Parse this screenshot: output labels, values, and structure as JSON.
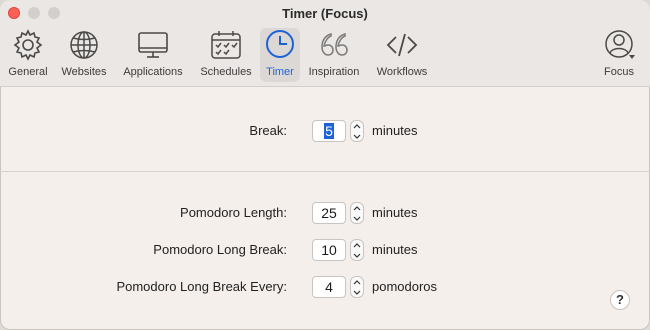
{
  "window": {
    "title": "Timer (Focus)"
  },
  "toolbar": {
    "items": [
      {
        "label": "General",
        "icon": "gear-icon"
      },
      {
        "label": "Websites",
        "icon": "globe-icon"
      },
      {
        "label": "Applications",
        "icon": "monitor-icon"
      },
      {
        "label": "Schedules",
        "icon": "calendar-icon"
      },
      {
        "label": "Timer",
        "icon": "clock-icon",
        "active": true
      },
      {
        "label": "Inspiration",
        "icon": "quote-icon"
      },
      {
        "label": "Workflows",
        "icon": "code-icon"
      },
      {
        "label": "Focus",
        "icon": "account-icon"
      }
    ]
  },
  "break_section": {
    "label": "Break:",
    "value": "5",
    "unit": "minutes"
  },
  "pomodoro_section": {
    "length": {
      "label": "Pomodoro Length:",
      "value": "25",
      "unit": "minutes"
    },
    "long_break": {
      "label": "Pomodoro Long Break:",
      "value": "10",
      "unit": "minutes"
    },
    "long_break_every": {
      "label": "Pomodoro Long Break Every:",
      "value": "4",
      "unit": "pomodoros"
    }
  },
  "help": {
    "label": "?"
  },
  "colors": {
    "accent": "#1e63d6",
    "close": "#fe5f57"
  }
}
